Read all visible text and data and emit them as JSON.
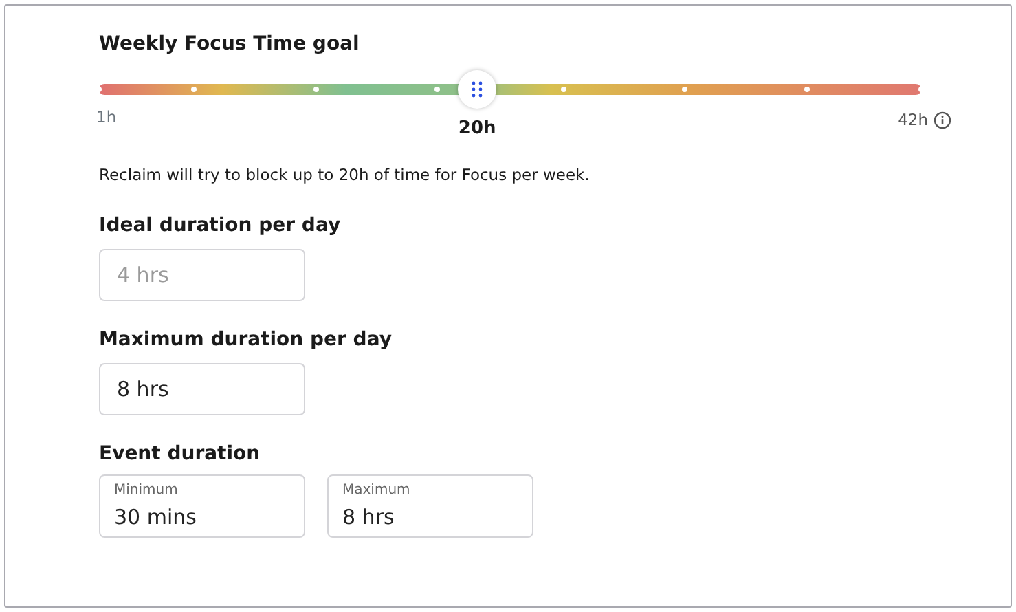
{
  "goal": {
    "title": "Weekly Focus Time goal",
    "level": 0.46,
    "min_label": "1h",
    "value_label": "20h",
    "max_label": "42h",
    "description": "Reclaim will try to block up to 20h of time for Focus per week."
  },
  "ideal": {
    "label": "Ideal duration per day",
    "placeholder": "4 hrs"
  },
  "maximum": {
    "label": "Maximum duration per day",
    "value": "8 hrs"
  },
  "event": {
    "label": "Event duration",
    "fields": [
      {
        "label": "Minimum",
        "value": "30 mins"
      },
      {
        "label": "Maximum",
        "value": "8 hrs"
      }
    ]
  }
}
